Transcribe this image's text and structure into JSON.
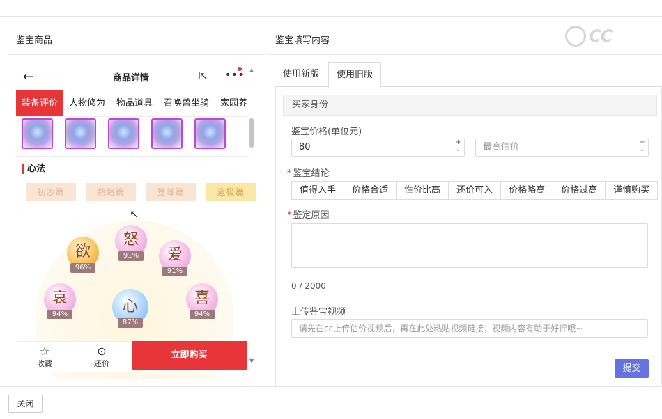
{
  "left_panel": {
    "title": "鉴宝商品"
  },
  "right_panel": {
    "title": "鉴宝填写内容"
  },
  "logo": {
    "text": "CC"
  },
  "phone": {
    "header": {
      "title": "商品详情"
    },
    "tabs": [
      "装备评价",
      "人物修为",
      "物品道具",
      "召唤兽坐骑",
      "家园养"
    ],
    "xinfa": {
      "title": "心法",
      "stages": [
        "初涉篇",
        "熟路篇",
        "登峰篇",
        "造极篇"
      ]
    },
    "wheel": {
      "nodes": [
        {
          "char": "欲",
          "pct": "96%"
        },
        {
          "char": "怒",
          "pct": "91%"
        },
        {
          "char": "爱",
          "pct": "91%"
        },
        {
          "char": "哀",
          "pct": "94%"
        },
        {
          "char": "心",
          "pct": "87%"
        },
        {
          "char": "喜",
          "pct": "94%"
        }
      ]
    },
    "bottom": {
      "favorite": "收藏",
      "bargain": "还价",
      "buy": "立即购买"
    }
  },
  "form": {
    "tabs": [
      "使用新版",
      "使用旧版"
    ],
    "section": "买家身份",
    "price_label": "鉴宝价格(单位元)",
    "price_value": "80",
    "max_price_placeholder": "最高估价",
    "conclusion_label": "鉴宝结论",
    "conclusions": [
      "值得入手",
      "价格合适",
      "性价比高",
      "还价可入",
      "价格略高",
      "价格过高",
      "谨慎购买"
    ],
    "reason_label": "鉴定原因",
    "counter": "0 / 2000",
    "video_label": "上传鉴宝视频",
    "video_placeholder": "请先在cc上传估价视频后，再在此处粘贴视频链接；视频内容有助于好评哦~",
    "submit": "提交"
  },
  "footer": {
    "close": "关闭"
  }
}
